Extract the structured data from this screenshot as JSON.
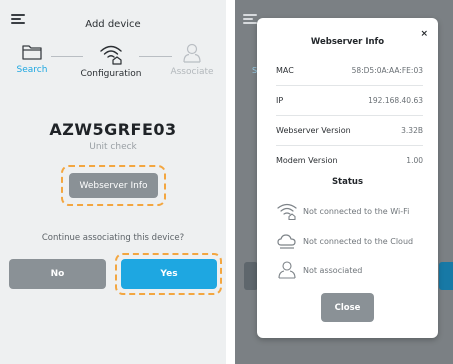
{
  "left": {
    "title": "Add device",
    "steps": [
      {
        "label": "Search",
        "icon": "folder-icon",
        "state": "done"
      },
      {
        "label": "Configuration",
        "icon": "wifi-home-icon",
        "state": "active"
      },
      {
        "label": "Associate",
        "icon": "person-icon",
        "state": "pending"
      }
    ],
    "device_name": "AZW5GRFE03",
    "unit_check": "Unit check",
    "webserver_button": "Webserver Info",
    "continue_prompt": "Continue associating this device?",
    "no_button": "No",
    "yes_button": "Yes"
  },
  "right": {
    "modal": {
      "title": "Webserver Info",
      "close_glyph": "×",
      "rows": [
        {
          "key": "MAC",
          "value": "58:D5:0A:AA:FE:03"
        },
        {
          "key": "IP",
          "value": "192.168.40.63"
        },
        {
          "key": "Webserver Version",
          "value": "3.32B"
        },
        {
          "key": "Modem Version",
          "value": "1.00"
        }
      ],
      "status_title": "Status",
      "status": [
        {
          "icon": "wifi-home-icon",
          "text": "Not connected to the Wi-Fi"
        },
        {
          "icon": "cloud-icon",
          "text": "Not connected to the Cloud"
        },
        {
          "icon": "person-icon",
          "text": "Not associated"
        }
      ],
      "close_button": "Close"
    }
  },
  "colors": {
    "accent": "#1ea7e1",
    "step_done": "#1ea7e1",
    "highlight_dash": "#f3a640",
    "button_grey": "#8a9196",
    "overlay": "#7b8084"
  }
}
